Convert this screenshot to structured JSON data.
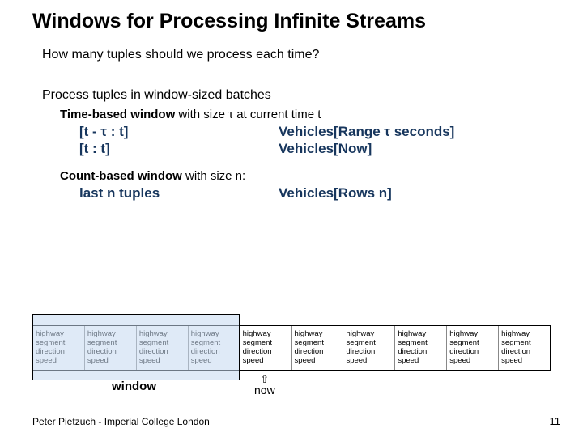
{
  "title": "Windows for Processing Infinite Streams",
  "question": "How many tuples should we process each time?",
  "section": "Process tuples in window-sized batches",
  "time": {
    "heading_pre": "Time-based window",
    "heading_post": " with size τ at current time t",
    "r1c1": "[t - τ : t]",
    "r1c2": "Vehicles[Range τ seconds]",
    "r2c1": "[t : t]",
    "r2c2": "Vehicles[Now]"
  },
  "count": {
    "heading_pre": "Count-based window",
    "heading_post": " with size n:",
    "r1c1": "last n tuples",
    "r1c2": "Vehicles[Rows n]"
  },
  "tuple_fields": [
    "highway",
    "segment",
    "direction",
    "speed"
  ],
  "tuple_count": 10,
  "window": {
    "start_idx": 0,
    "span": 4,
    "label": "window"
  },
  "now": {
    "idx": 4,
    "label": "now"
  },
  "footer_left": "Peter Pietzuch - Imperial College London",
  "page_num": "11"
}
